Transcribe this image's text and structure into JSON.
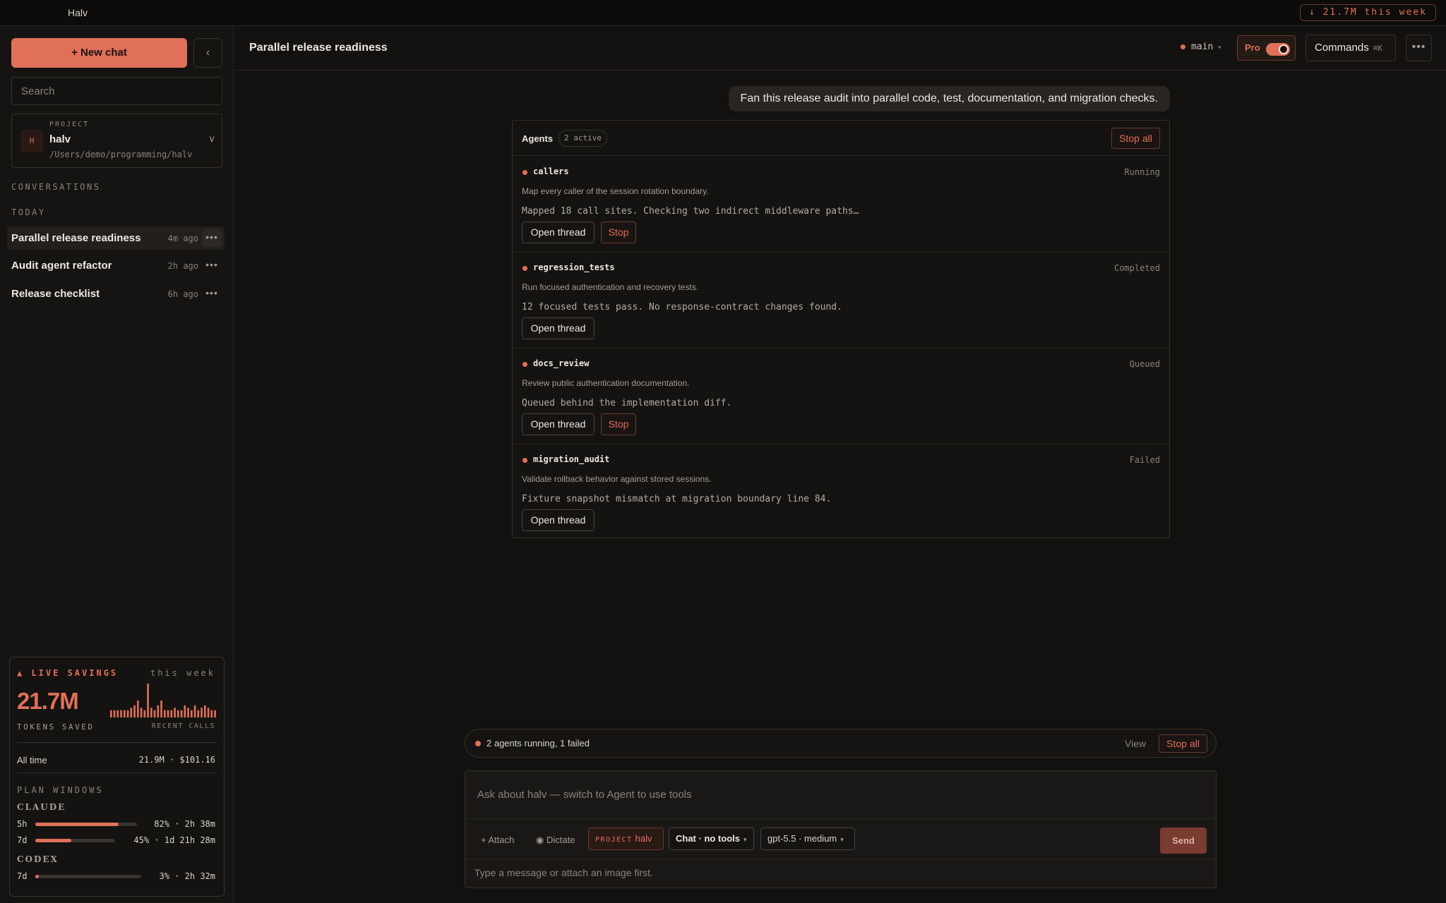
{
  "app": {
    "title": "Halv",
    "week_badge": "↓ 21.7M this week"
  },
  "sidebar": {
    "new_chat_label": "+ New chat",
    "collapse_label": "‹",
    "search_placeholder": "Search",
    "project": {
      "kicker": "PROJECT",
      "avatar": "H",
      "name": "halv",
      "path": "/Users/demo/programming/halv",
      "chevron": "v"
    },
    "conversations_label": "CONVERSATIONS",
    "today_label": "TODAY",
    "conversations": [
      {
        "title": "Parallel release readiness",
        "time": "4m ago",
        "active": true
      },
      {
        "title": "Audit agent refactor",
        "time": "2h ago",
        "active": false
      },
      {
        "title": "Release checklist",
        "time": "6h ago",
        "active": false
      }
    ],
    "more_label": "•••"
  },
  "savings": {
    "live_label": "▲ LIVE SAVINGS",
    "period_label": "this week",
    "big_value": "21.7M",
    "tokens_label": "TOKENS SAVED",
    "recent_label": "RECENT CALLS",
    "recent_calls": [
      3,
      3,
      3,
      3,
      3,
      3,
      4,
      5,
      7,
      4,
      3,
      14,
      4,
      3,
      5,
      7,
      3,
      3,
      3,
      4,
      3,
      3,
      5,
      4,
      3,
      5,
      3,
      4,
      5,
      4,
      3,
      3
    ],
    "all_time_label": "All time",
    "all_time_value": "21.9M · $101.16",
    "plan_label": "PLAN WINDOWS",
    "groups": [
      {
        "name": "CLAUDE",
        "rows": [
          {
            "label": "5h",
            "percent": 82,
            "value": "82% · 2h 38m"
          },
          {
            "label": "7d",
            "percent": 45,
            "value": "45% · 1d 21h 28m"
          }
        ]
      },
      {
        "name": "CODEX",
        "rows": [
          {
            "label": "7d",
            "percent": 3,
            "value": "3% · 2h 32m"
          }
        ]
      }
    ]
  },
  "header": {
    "title": "Parallel release readiness",
    "branch": "main",
    "pro_label": "Pro",
    "commands_label": "Commands",
    "commands_kbd": "⌘K",
    "more_label": "•••"
  },
  "chat": {
    "user_message": "Fan this release audit into parallel code, test, documentation, and migration checks."
  },
  "agents": {
    "title": "Agents",
    "active_count": "2 active",
    "stop_all_label": "Stop all",
    "open_thread_label": "Open thread",
    "stop_label": "Stop",
    "items": [
      {
        "name": "callers",
        "status": "Running",
        "description": "Map every caller of the session rotation boundary.",
        "log": "Mapped 18 call sites. Checking two indirect middleware paths…",
        "can_stop": true
      },
      {
        "name": "regression_tests",
        "status": "Completed",
        "description": "Run focused authentication and recovery tests.",
        "log": "12 focused tests pass. No response-contract changes found.",
        "can_stop": false
      },
      {
        "name": "docs_review",
        "status": "Queued",
        "description": "Review public authentication documentation.",
        "log": "Queued behind the implementation diff.",
        "can_stop": true
      },
      {
        "name": "migration_audit",
        "status": "Failed",
        "description": "Validate rollback behavior against stored sessions.",
        "log": "Fixture snapshot mismatch at migration boundary line 84.",
        "can_stop": false
      }
    ]
  },
  "run_bar": {
    "text": "2 agents running, 1 failed",
    "view_label": "View",
    "stop_all_label": "Stop all"
  },
  "composer": {
    "placeholder": "Ask about halv — switch to Agent to use tools",
    "attach_label": "+ Attach",
    "dictate_label": "◉ Dictate",
    "project_kicker": "PROJECT",
    "project_value": "halv",
    "mode_label": "Chat · no tools",
    "model_label": "gpt-5.5 · medium",
    "send_label": "Send",
    "hint": "Type a message or attach an image first."
  },
  "colors": {
    "accent": "#e0705a",
    "background": "#121110",
    "surface": "#151412",
    "border": "#36302a"
  }
}
